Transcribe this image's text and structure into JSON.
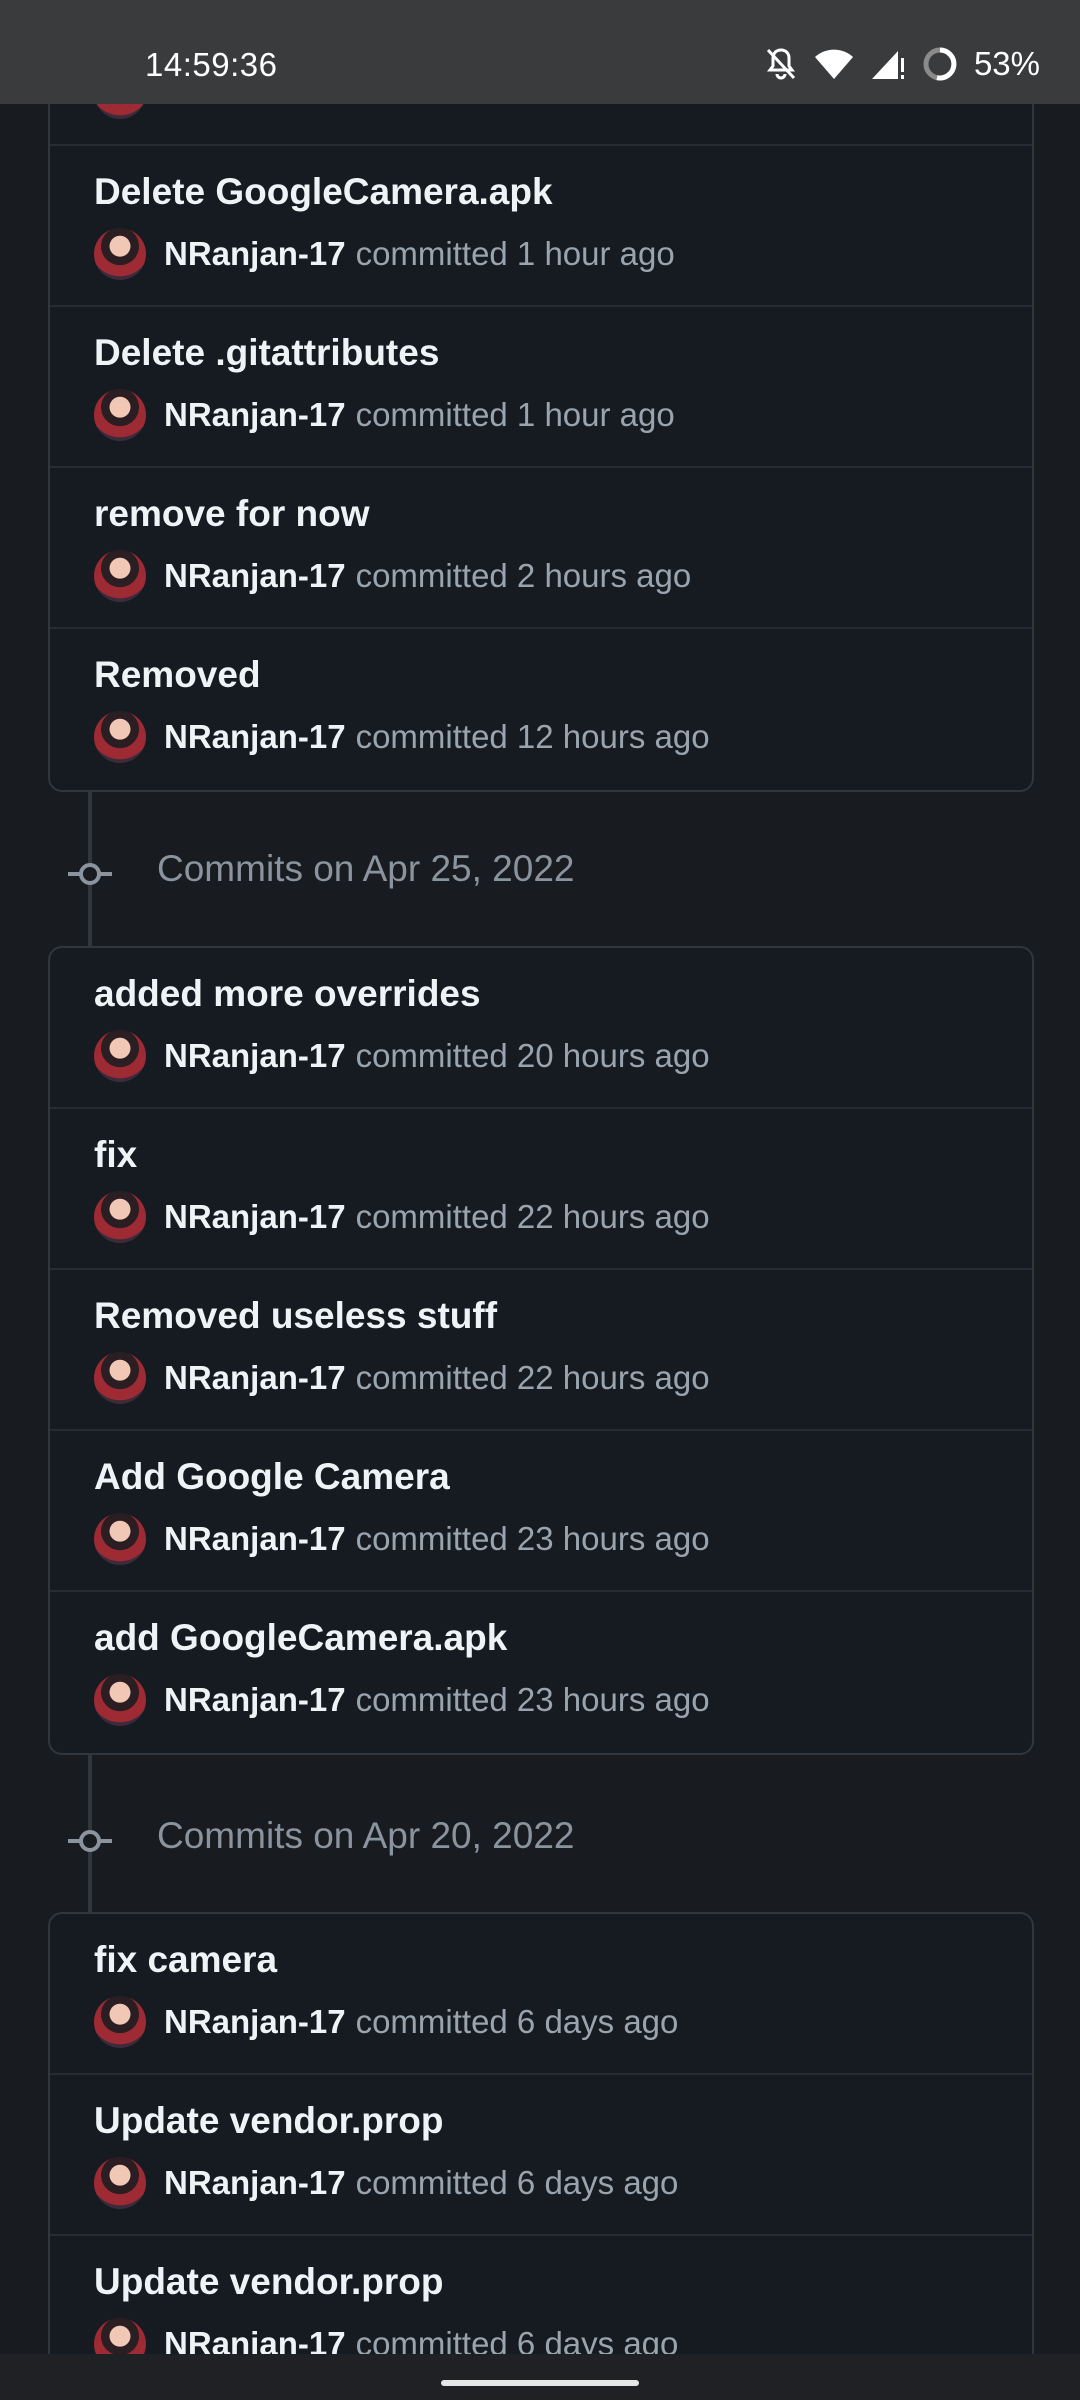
{
  "status_bar": {
    "time": "14:59:36",
    "battery": "53%",
    "icons": [
      "notifications-off-icon",
      "wifi-icon",
      "cell-signal-icon",
      "battery-icon"
    ]
  },
  "groups": [
    {
      "date_label": "",
      "commits": [
        {
          "message": "Delete GoogleCamera.apk",
          "author": "NRanjan-17",
          "time": "committed 1 hour ago"
        },
        {
          "message": "Delete .gitattributes",
          "author": "NRanjan-17",
          "time": "committed 1 hour ago"
        },
        {
          "message": "remove for now",
          "author": "NRanjan-17",
          "time": "committed 2 hours ago"
        },
        {
          "message": "Removed",
          "author": "NRanjan-17",
          "time": "committed 12 hours ago"
        }
      ]
    },
    {
      "date_label": "Commits on Apr 25, 2022",
      "commits": [
        {
          "message": "added more overrides",
          "author": "NRanjan-17",
          "time": "committed 20 hours ago"
        },
        {
          "message": "fix",
          "author": "NRanjan-17",
          "time": "committed 22 hours ago"
        },
        {
          "message": "Removed useless stuff",
          "author": "NRanjan-17",
          "time": "committed 22 hours ago"
        },
        {
          "message": "Add Google Camera",
          "author": "NRanjan-17",
          "time": "committed 23 hours ago"
        },
        {
          "message": "add GoogleCamera.apk",
          "author": "NRanjan-17",
          "time": "committed 23 hours ago"
        }
      ]
    },
    {
      "date_label": "Commits on Apr 20, 2022",
      "commits": [
        {
          "message": "fix camera",
          "author": "NRanjan-17",
          "time": "committed 6 days ago"
        },
        {
          "message": "Update vendor.prop",
          "author": "NRanjan-17",
          "time": "committed 6 days ago"
        },
        {
          "message": "Update vendor.prop",
          "author": "NRanjan-17",
          "time": "committed 6 days ago"
        }
      ]
    }
  ],
  "colors": {
    "background": "#181b20",
    "card": "#161b22",
    "border": "#30363d",
    "muted_text": "#9aa4ae"
  }
}
